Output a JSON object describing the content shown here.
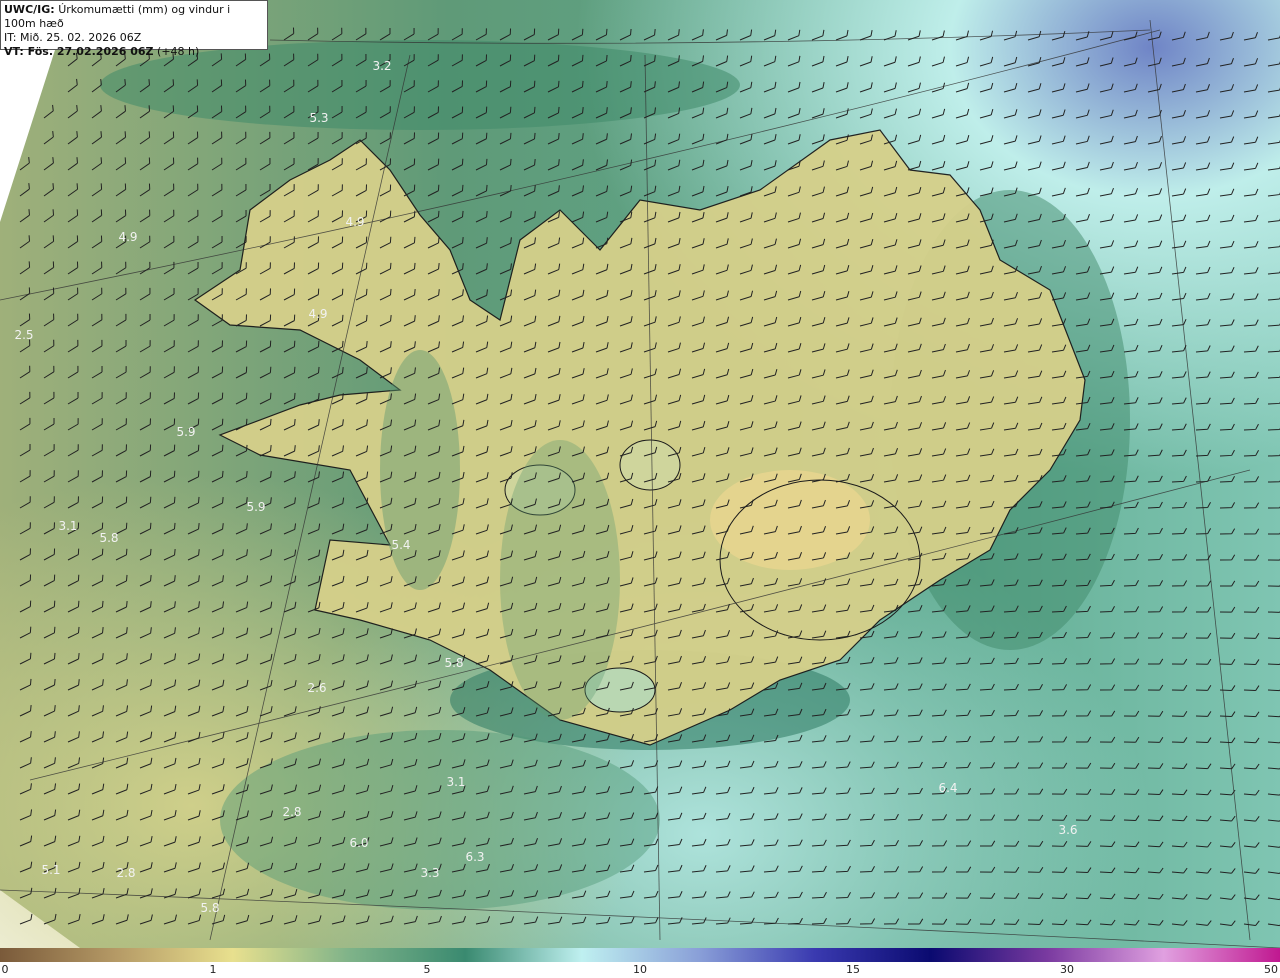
{
  "title": {
    "product": "UWC/IG:",
    "description": "Úrkomumætti (mm) og vindur i 100m hæð",
    "init_time": "IT: Mið. 25. 02. 2026 06Z",
    "valid_prefix": "VT: Fös. 27.02.2026 06Z",
    "valid_suffix": "(+48 h)"
  },
  "values": [
    {
      "text": "3.2"
    },
    {
      "text": "5.3"
    },
    {
      "text": "4.9"
    },
    {
      "text": "4.9"
    },
    {
      "text": "4.9"
    },
    {
      "text": "2.5"
    },
    {
      "text": "5.9"
    },
    {
      "text": "5.9"
    },
    {
      "text": "3.1"
    },
    {
      "text": "5.8"
    },
    {
      "text": "5.4"
    },
    {
      "text": "5.8"
    },
    {
      "text": "2.6"
    },
    {
      "text": "3.1"
    },
    {
      "text": "2.8"
    },
    {
      "text": "6.0"
    },
    {
      "text": "6.3"
    },
    {
      "text": "3.3"
    },
    {
      "text": "5.1"
    },
    {
      "text": "2.8"
    },
    {
      "text": "5.8"
    },
    {
      "text": "6.4"
    },
    {
      "text": "3.6"
    }
  ],
  "colorbar": {
    "ticks": [
      "0",
      "1",
      "5",
      "10",
      "15",
      "30",
      "50"
    ],
    "colors": [
      "#7a5a3a",
      "#b59a66",
      "#e8e08e",
      "#7fb389",
      "#3a8a70",
      "#bff0f0",
      "#8aa0d8",
      "#3a3ab0",
      "#0a0a70",
      "#7a3aa0",
      "#e0a0e0",
      "#c01890"
    ]
  },
  "map_colors": {
    "land_yellow": "#d9d58c",
    "green_mid": "#7aa57a",
    "green_dark": "#2e7a62",
    "cyan": "#bfeeea",
    "blue": "#6f84c6",
    "outline": "#1a1a1a"
  }
}
